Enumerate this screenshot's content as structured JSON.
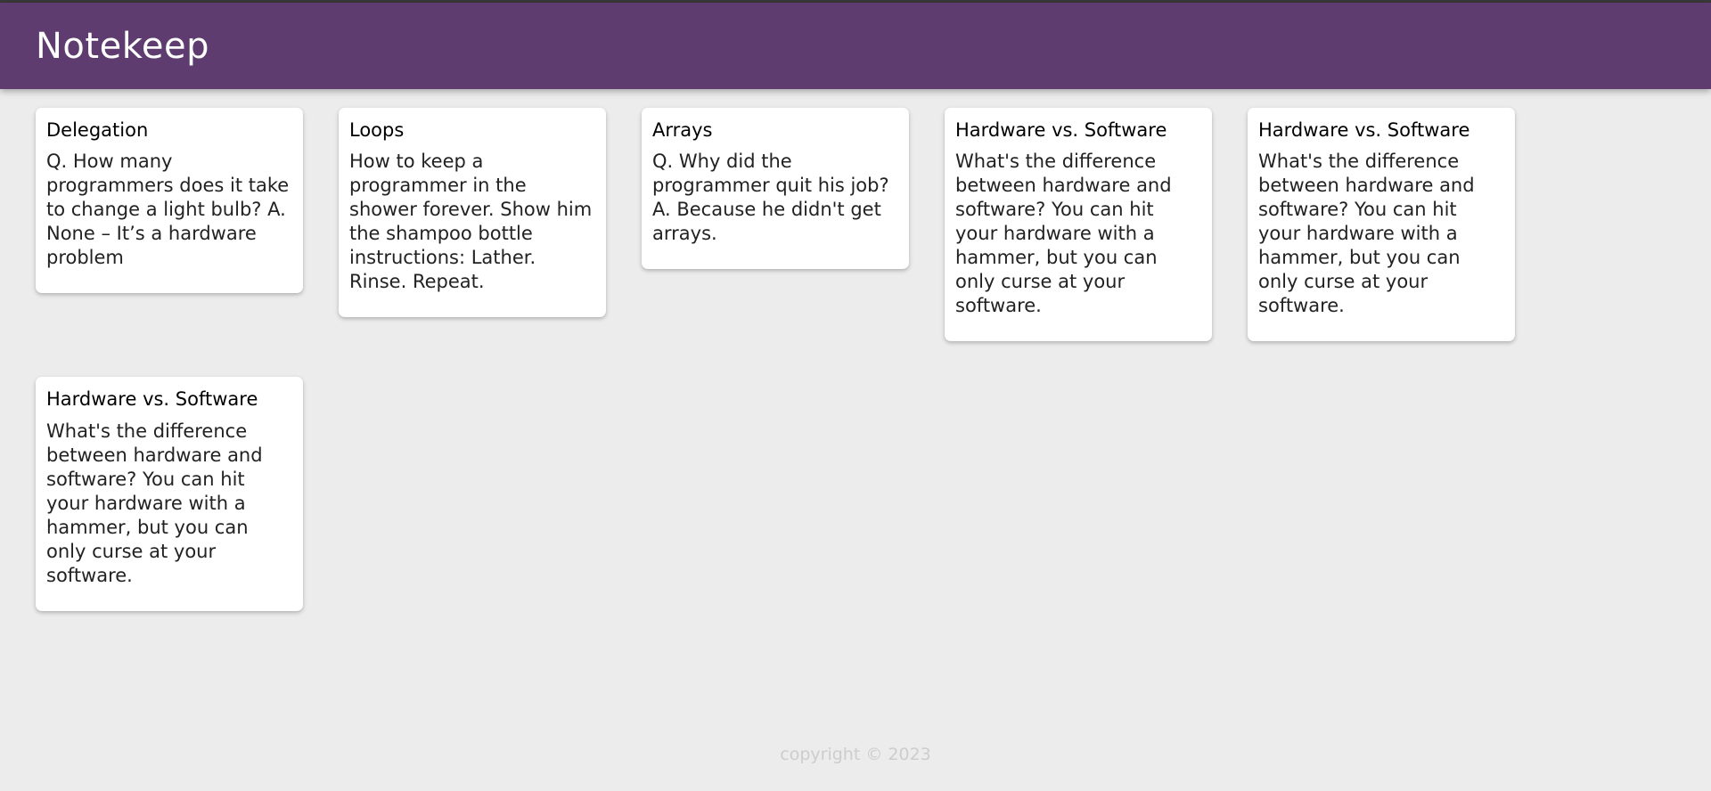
{
  "app": {
    "title": "Notekeep"
  },
  "notes": [
    {
      "title": "Delegation",
      "content": "Q. How many programmers does it take to change a light bulb? A. None – It’s a hardware problem"
    },
    {
      "title": "Loops",
      "content": "How to keep a programmer in the shower forever. Show him the shampoo bottle instructions: Lather. Rinse. Repeat."
    },
    {
      "title": "Arrays",
      "content": "Q. Why did the programmer quit his job? A. Because he didn't get arrays."
    },
    {
      "title": "Hardware vs. Software",
      "content": "What's the difference between hardware and software? You can hit your hardware with a hammer, but you can only curse at your software."
    },
    {
      "title": "Hardware vs. Software",
      "content": "What's the difference between hardware and software? You can hit your hardware with a hammer, but you can only curse at your software."
    },
    {
      "title": "Hardware vs. Software",
      "content": "What's the difference between hardware and software? You can hit your hardware with a hammer, but you can only curse at your software."
    }
  ],
  "footer": {
    "text": "copyright © 2023"
  },
  "colors": {
    "header_bg": "#5e3c6f",
    "page_bg": "#ececec",
    "card_bg": "#ffffff",
    "footer_text": "#cdcdcd"
  }
}
